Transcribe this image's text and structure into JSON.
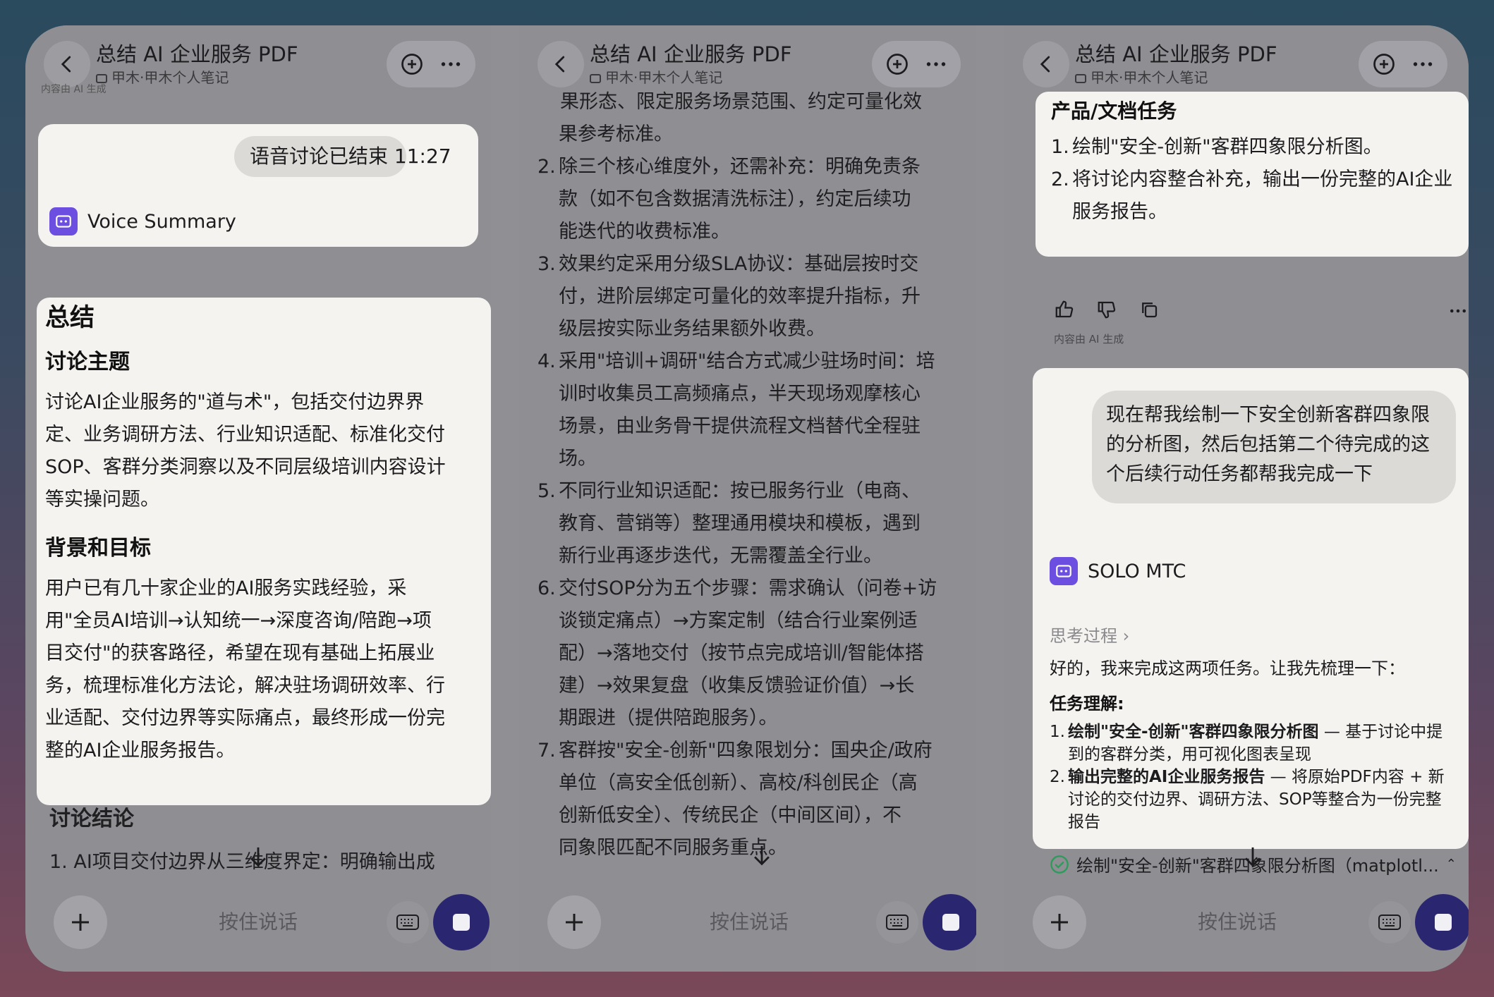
{
  "header": {
    "title": "总结 AI 企业服务 PDF",
    "subtitle": "甲木·甲木个人笔记"
  },
  "panel1": {
    "top_tiny": "内容由 AI 生成",
    "voice_ended": "语音讨论已结束 11:27",
    "bot_name": "Voice Summary",
    "summary_title": "总结",
    "topic_heading": "讨论主题",
    "topic_lines": [
      "讨论AI企业服务的\"道与术\"，包括交付边界界",
      "定、业务调研方法、行业知识适配、标准化交付",
      "SOP、客群分类洞察以及不同层级培训内容设计",
      "等实操问题。"
    ],
    "bg_heading": "背景和目标",
    "bg_lines": [
      "用户已有几十家企业的AI服务实践经验，采",
      "用\"全员AI培训→认知统一→深度咨询/陪跑→项",
      "目交付\"的获客路径，希望在现有基础上拓展业",
      "务，梳理标准化方法论，解决驻场调研效率、行",
      "业适配、交付边界等实际痛点，最终形成一份完",
      "整的AI企业服务报告。"
    ],
    "conclusion_heading": "讨论结论",
    "conclusion_first": "1. AI项目交付边界从三维度界定：明确输出成"
  },
  "panel2": {
    "top_partial": "果形态、限定服务场景范围、约定可量化效",
    "lines": [
      {
        "num": "",
        "text": "果参考标准。"
      },
      {
        "num": "2.",
        "text": "除三个核心维度外，还需补充：明确免责条"
      },
      {
        "num": "",
        "text": "款（如不包含数据清洗标注），约定后续功"
      },
      {
        "num": "",
        "text": "能迭代的收费标准。"
      },
      {
        "num": "3.",
        "text": "效果约定采用分级SLA协议：基础层按时交"
      },
      {
        "num": "",
        "text": "付，进阶层绑定可量化的效率提升指标，升"
      },
      {
        "num": "",
        "text": "级层按实际业务结果额外收费。"
      },
      {
        "num": "4.",
        "text": "采用\"培训+调研\"结合方式减少驻场时间：培"
      },
      {
        "num": "",
        "text": "训时收集员工高频痛点，半天现场观摩核心"
      },
      {
        "num": "",
        "text": "场景，由业务骨干提供流程文档替代全程驻"
      },
      {
        "num": "",
        "text": "场。"
      },
      {
        "num": "5.",
        "text": "不同行业知识适配：按已服务行业（电商、"
      },
      {
        "num": "",
        "text": "教育、营销等）整理通用模块和模板，遇到"
      },
      {
        "num": "",
        "text": "新行业再逐步迭代，无需覆盖全行业。"
      },
      {
        "num": "6.",
        "text": "交付SOP分为五个步骤：需求确认（问卷+访"
      },
      {
        "num": "",
        "text": "谈锁定痛点）→方案定制（结合行业案例适"
      },
      {
        "num": "",
        "text": "配）→落地交付（按节点完成培训/智能体搭"
      },
      {
        "num": "",
        "text": "建）→效果复盘（收集反馈验证价值）→长"
      },
      {
        "num": "",
        "text": "期跟进（提供陪跑服务）。"
      },
      {
        "num": "7.",
        "text": "客群按\"安全-创新\"四象限划分：国央企/政府"
      },
      {
        "num": "",
        "text": "单位（高安全低创新）、高校/科创民企（高"
      },
      {
        "num": "",
        "text": "创新低安全）、传统民企（中间区间），不"
      },
      {
        "num": "",
        "text": "同象限匹配不同服务重点。"
      }
    ]
  },
  "panel3": {
    "task_heading": "产品/文档任务",
    "tasks": [
      {
        "num": "1.",
        "lines": [
          "绘制\"安全-创新\"客群四象限分析图。"
        ]
      },
      {
        "num": "2.",
        "lines": [
          "将讨论内容整合补充，输出一份完整的AI企业",
          "服务报告。"
        ]
      }
    ],
    "ai_tag": "内容由 AI 生成",
    "user_msg_lines": [
      "现在帮我绘制一下安全创新客群四象限",
      "的分析图，然后包括第二个待完成的这",
      "个后续行动任务都帮我完成一下"
    ],
    "bot_name": "SOLO MTC",
    "thinking": "思考过程",
    "reply_intro": "好的，我来完成这两项任务。让我先梳理一下：",
    "understanding": "任务理解:",
    "items": [
      {
        "num": "1.",
        "bold": "绘制\"安全-创新\"客群四象限分析图",
        "rest": " — 基于讨论中提",
        "line2": "到的客群分类，用可视化图表呈现"
      },
      {
        "num": "2.",
        "bold": "输出完整的AI企业服务报告",
        "rest": " — 将原始PDF内容 + 新",
        "line2": "讨论的交付边界、调研方法、SOP等整合为一份完整",
        "line3": "报告"
      }
    ],
    "progress_step": "绘制\"安全-创新\"客群四象限分析图（matplotl..."
  },
  "bottom": {
    "hold_to_talk": "按住说话"
  },
  "icons": [
    "back-icon",
    "new-chat-icon",
    "more-icon",
    "plus-icon",
    "keyboard-icon",
    "stop-icon",
    "down-arrow-icon",
    "bot-icon",
    "thumb-up-icon",
    "thumb-down-icon",
    "copy-icon",
    "check-icon",
    "chevron-icon"
  ],
  "colors": {
    "accent": "#6c4fe0",
    "stop_button": "#2a2670",
    "check": "#2e9b5c"
  }
}
